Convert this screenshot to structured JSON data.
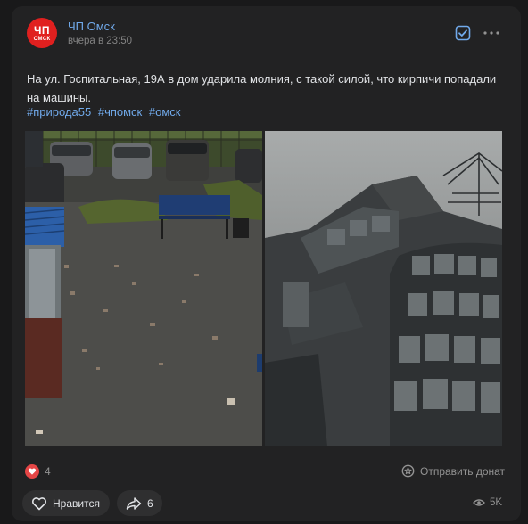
{
  "post": {
    "author": "ЧП Омск",
    "avatar_text_line1": "ЧП",
    "avatar_text_line2": "ОМСК",
    "time": "вчера в 23:50",
    "text": "На ул. Госпитальная, 19А в дом ударила молния, с такой силой, что кирпичи попадали на машины.",
    "hashtags": [
      "#природа55",
      "#чпомск",
      "#омск"
    ]
  },
  "photos": [
    {
      "icon": "photo-courtyard-bricks"
    },
    {
      "icon": "photo-building-facade"
    }
  ],
  "footer": {
    "likes_count": "4",
    "donate_label": "Отправить донат",
    "like_button_label": "Нравится",
    "share_count": "6",
    "views_count": "5K"
  },
  "colors": {
    "background": "#19191a",
    "card": "#222223",
    "link": "#71aaeb",
    "like_red": "#e64646",
    "avatar_red": "#e0201f"
  }
}
